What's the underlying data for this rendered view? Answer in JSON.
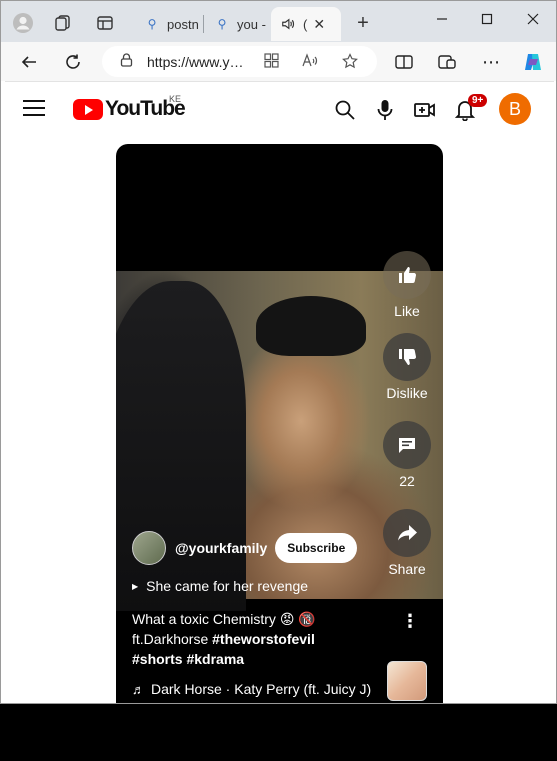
{
  "browser": {
    "tabs": [
      {
        "label": "postn",
        "icon": "search-icon"
      },
      {
        "label": "you -",
        "icon": "search-icon"
      },
      {
        "label": "(",
        "icon": "speaker-icon",
        "active": true
      }
    ],
    "address_url": "https://www.y…",
    "window_controls": [
      "minimize",
      "maximize",
      "close"
    ]
  },
  "youtube": {
    "logo_text": "YouTube",
    "country_code": "KE",
    "notification_count": "9+",
    "avatar_letter": "B"
  },
  "short": {
    "like_label": "Like",
    "dislike_label": "Dislike",
    "comment_count": "22",
    "share_label": "Share",
    "channel_handle": "@yourkfamily",
    "subscribe_label": "Subscribe",
    "sound_caption": "She came for her revenge",
    "title_plain": "What a toxic Chemistry 😡 🔞",
    "title_line2_plain": "ft.Darkhorse ",
    "title_tag1": "#theworstofevil",
    "title_tag2": "#shorts",
    "title_tag3": "#kdrama",
    "music": "Dark Horse · Katy Perry (ft. Juicy J)"
  },
  "colors": {
    "brand_red": "#ff0000",
    "avatar_orange": "#ef6c00",
    "badge_red": "#cc0000"
  }
}
